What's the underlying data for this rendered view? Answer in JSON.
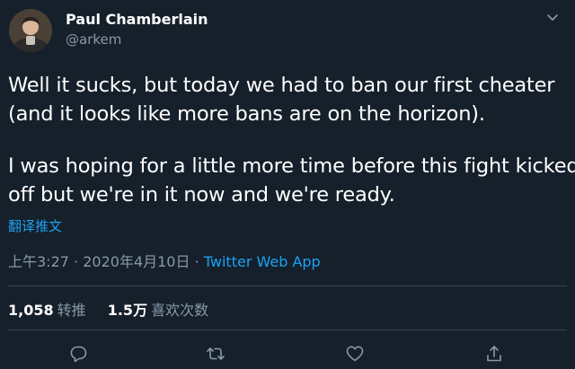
{
  "author": {
    "name": "Paul Chamberlain",
    "handle": "@arkem"
  },
  "tweet": {
    "line1": "Well it sucks, but today we had to ban our first cheater",
    "line2": "(and it looks like more bans are on the horizon).",
    "line3": "I was hoping for a little more time before this fight kicked",
    "line4": "off but we're in it now and we're ready.",
    "translate_label": "翻译推文"
  },
  "meta": {
    "time": "上午3:27",
    "separator": "·",
    "date": "2020年4月10日",
    "source": "Twitter Web App"
  },
  "stats": {
    "retweets_count": "1,058",
    "retweets_label": "转推",
    "likes_count": "1.5万",
    "likes_label": "喜欢次数"
  },
  "icons": {
    "caret": "chevron-down-icon",
    "reply": "reply-icon",
    "retweet": "retweet-icon",
    "like": "heart-icon",
    "share": "share-icon"
  },
  "colors": {
    "background": "#15202b",
    "text": "#ffffff",
    "secondary": "#8899a6",
    "link": "#1da1f2",
    "divider": "#38444d"
  }
}
